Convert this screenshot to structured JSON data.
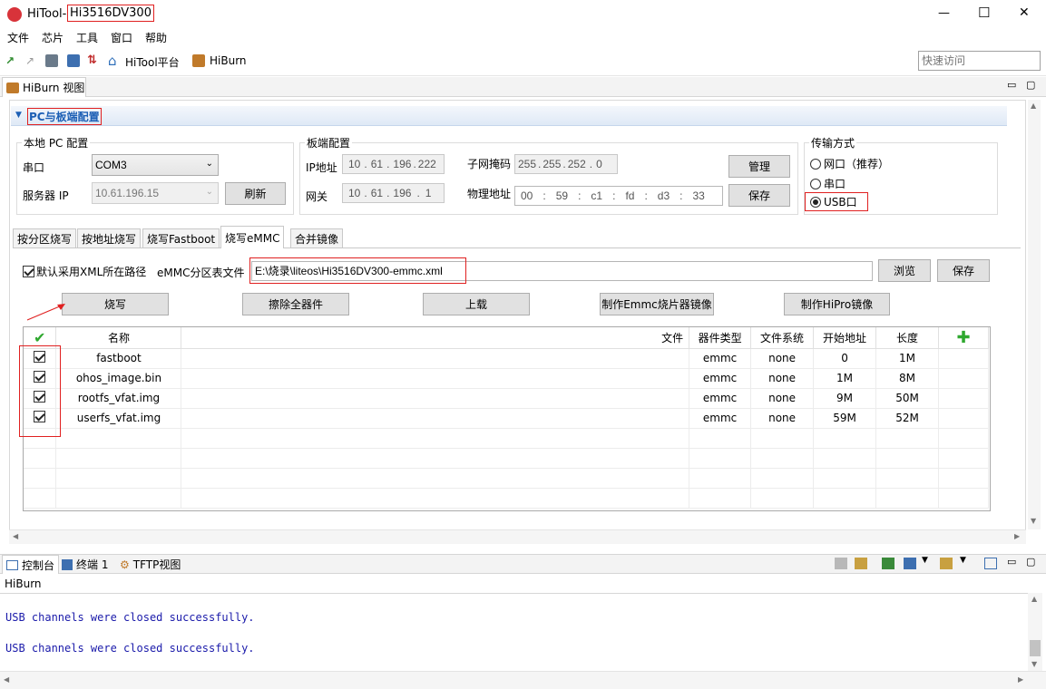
{
  "window": {
    "title_prefix": "HiTool-",
    "title_chip": "Hi3516DV300",
    "minimize": "—",
    "maximize": "☐",
    "close": "✕"
  },
  "menu": [
    "文件",
    "芯片",
    "工具",
    "窗口",
    "帮助"
  ],
  "toolbar": {
    "hitool_platform": "HiTool平台",
    "hiburn": "HiBurn",
    "quick_access_placeholder": "快速访问"
  },
  "view_tab": {
    "label": "HiBurn 视图"
  },
  "section": {
    "title": "PC与板端配置"
  },
  "local_pc": {
    "group_title": "本地 PC 配置",
    "serial_label": "串口",
    "serial_value": "COM3",
    "server_ip_label": "服务器 IP",
    "server_ip_value": "10.61.196.15",
    "refresh_button": "刷新"
  },
  "board": {
    "group_title": "板端配置",
    "ip_label": "IP地址",
    "ip_octets": [
      "10",
      "61",
      "196",
      "222"
    ],
    "gateway_label": "网关",
    "gateway_octets": [
      "10",
      "61",
      "196",
      "1"
    ],
    "mask_label": "子网掩码",
    "mask_octets": [
      "255",
      "255",
      "252",
      "0"
    ],
    "mac_label": "物理地址",
    "mac_parts": [
      "00",
      "59",
      "c1",
      "fd",
      "d3",
      "33"
    ],
    "manage_button": "管理",
    "save_button": "保存"
  },
  "transfer": {
    "group_title": "传输方式",
    "options": [
      "网口（推荐）",
      "串口",
      "USB口"
    ],
    "selected": "USB口"
  },
  "burn_tabs": [
    "按分区烧写",
    "按地址烧写",
    "烧写Fastboot",
    "烧写eMMC",
    "合并镜像"
  ],
  "active_tab": "烧写eMMC",
  "emmc": {
    "use_xml_label": "默认采用XML所在路径",
    "use_xml_checked": true,
    "table_file_label": "eMMC分区表文件",
    "table_file_value": "E:\\烧录\\liteos\\Hi3516DV300-emmc.xml",
    "browse_button": "浏览",
    "save_button": "保存"
  },
  "actions": {
    "burn": "烧写",
    "erase_all": "擦除全器件",
    "upload": "上载",
    "make_emmc_image": "制作Emmc烧片器镜像",
    "make_hipro_image": "制作HiPro镜像"
  },
  "table": {
    "columns": [
      "名称",
      "文件",
      "器件类型",
      "文件系统",
      "开始地址",
      "长度"
    ],
    "rows": [
      {
        "name": "fastboot",
        "file": "",
        "device": "emmc",
        "fs": "none",
        "start": "0",
        "length": "1M",
        "checked": true
      },
      {
        "name": "ohos_image.bin",
        "file": "",
        "device": "emmc",
        "fs": "none",
        "start": "1M",
        "length": "8M",
        "checked": true
      },
      {
        "name": "rootfs_vfat.img",
        "file": "",
        "device": "emmc",
        "fs": "none",
        "start": "9M",
        "length": "50M",
        "checked": true
      },
      {
        "name": "userfs_vfat.img",
        "file": "",
        "device": "emmc",
        "fs": "none",
        "start": "59M",
        "length": "52M",
        "checked": true
      }
    ]
  },
  "console": {
    "tabs": [
      "控制台",
      "终端 1",
      "TFTP视图"
    ],
    "source": "HiBurn",
    "lines": [
      "USB channels were closed successfully.",
      "USB channels were closed successfully."
    ]
  },
  "colors": {
    "accent_blue": "#1c5fb5",
    "console_text": "#1a1aaa",
    "highlight_red": "#e02020",
    "add_green": "#2fa82f"
  }
}
